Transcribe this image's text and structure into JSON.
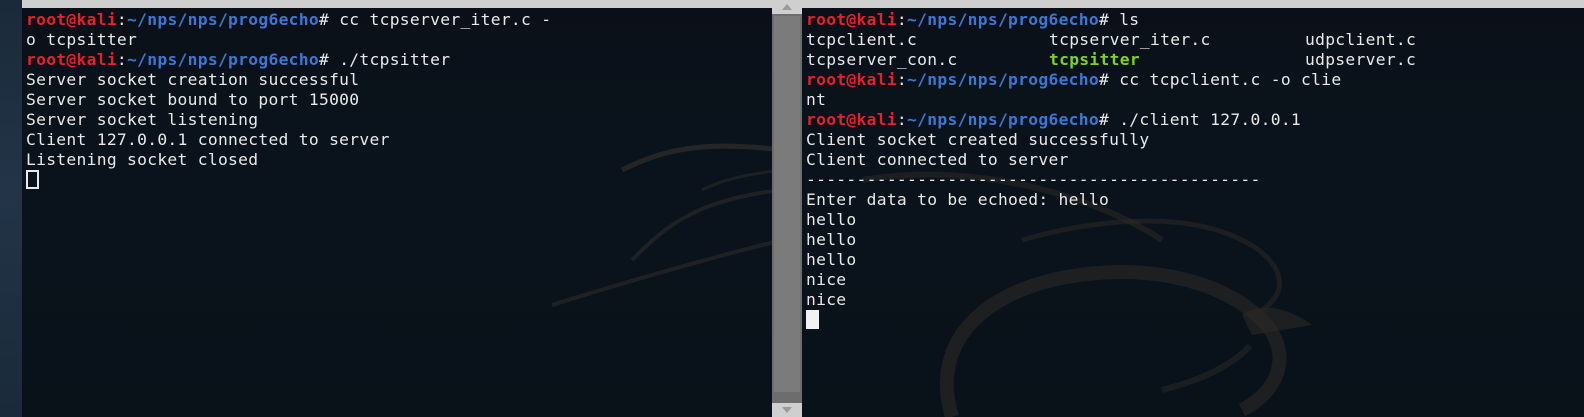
{
  "prompt": {
    "user": "root@kali",
    "sep": ":",
    "path": "~/nps/nps/prog6echo",
    "hash": "#"
  },
  "left_terminal": {
    "lines": [
      {
        "type": "cmd",
        "text": " cc tcpserver_iter.c -"
      },
      {
        "type": "out",
        "text": "o tcpsitter"
      },
      {
        "type": "cmd",
        "text": " ./tcpsitter"
      },
      {
        "type": "out",
        "text": "Server socket creation successful"
      },
      {
        "type": "out",
        "text": "Server socket bound to port 15000"
      },
      {
        "type": "out",
        "text": "Server socket listening"
      },
      {
        "type": "out",
        "text": "Client 127.0.0.1 connected to server"
      },
      {
        "type": "out",
        "text": "Listening socket closed"
      }
    ]
  },
  "right_terminal": {
    "cmd_ls": " ls",
    "ls_rows": [
      [
        "tcpclient.c",
        "tcpserver_iter.c",
        "udpclient.c"
      ],
      [
        "tcpserver_con.c",
        "tcpsitter",
        "udpserver.c"
      ]
    ],
    "cmd_cc": " cc tcpclient.c -o clie",
    "cmd_cc_wrap": "nt",
    "cmd_run": " ./client 127.0.0.1",
    "output": [
      "Client socket created successfully",
      "Client connected to server",
      "---------------------------------------------",
      "Enter data to be echoed: hello",
      "hello",
      "hello",
      "hello",
      "nice",
      "nice"
    ]
  },
  "colors": {
    "prompt_user": "#e8202a",
    "prompt_path": "#3a78d6",
    "executable": "#7ed321",
    "text": "#e9e9e9"
  },
  "icons": {
    "scroll_up": "triangle-up-icon",
    "scroll_down": "triangle-down-icon",
    "background": "kali-dragon-logo"
  }
}
